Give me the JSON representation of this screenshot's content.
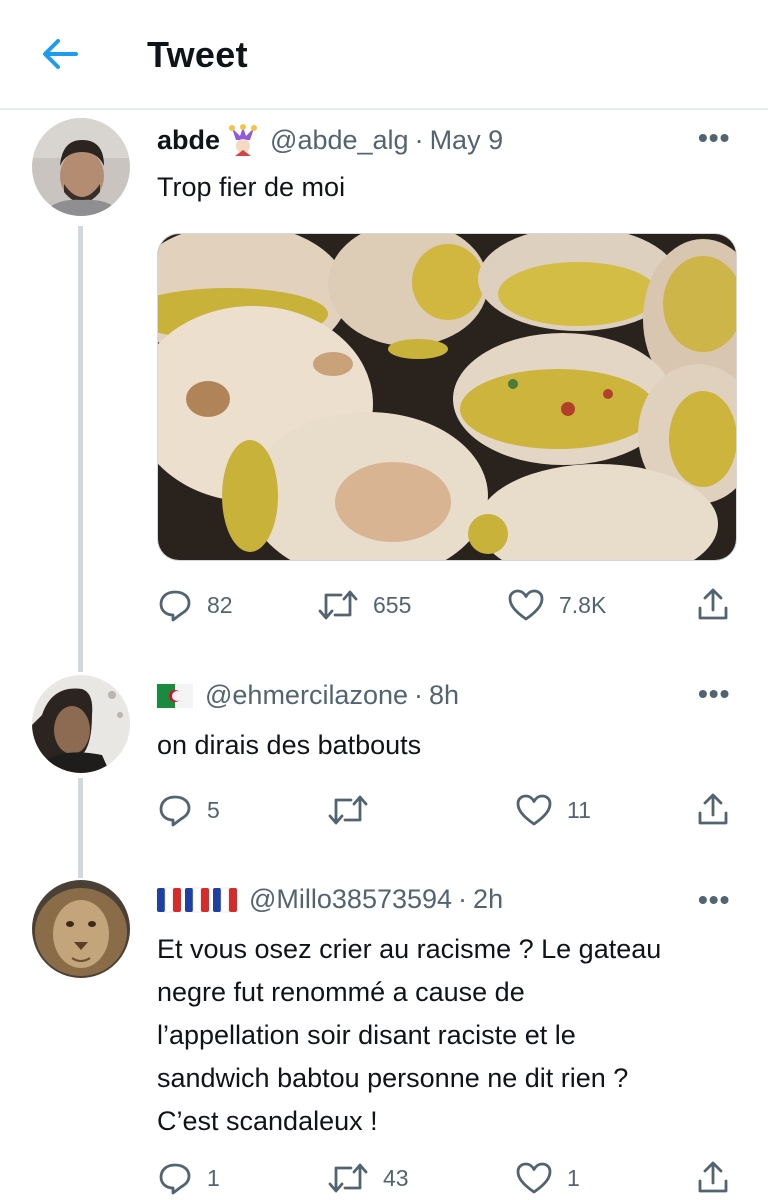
{
  "header": {
    "title": "Tweet"
  },
  "tweets": [
    {
      "name": "abde",
      "handle": "@abde_alg",
      "date": "May 9",
      "text": "Trop fier de moi",
      "counts": {
        "replies": "82",
        "retweets": "655",
        "likes": "7.8K"
      }
    },
    {
      "name": "",
      "handle": "@ehmercilazone",
      "date": "8h",
      "text": "on dirais des batbouts",
      "counts": {
        "replies": "5",
        "retweets": "",
        "likes": "11"
      }
    },
    {
      "name": "",
      "handle": "@Millo38573594",
      "date": "2h",
      "text_lines": [
        "Et vous osez crier au racisme ? Le gateau",
        "negre fut renommé a cause de",
        "l’appellation soir disant raciste et le",
        "sandwich babtou personne ne dit rien ?",
        "C’est scandaleux !"
      ],
      "counts": {
        "replies": "1",
        "retweets": "43",
        "likes": "1"
      }
    }
  ],
  "icons": {
    "back": "back-arrow-icon",
    "more": "more-icon",
    "reply": "reply-icon",
    "retweet": "retweet-icon",
    "like": "like-icon",
    "share": "share-icon"
  },
  "colors": {
    "accent": "#1d9bf0",
    "muted": "#536471",
    "border": "#e6ecf0"
  }
}
